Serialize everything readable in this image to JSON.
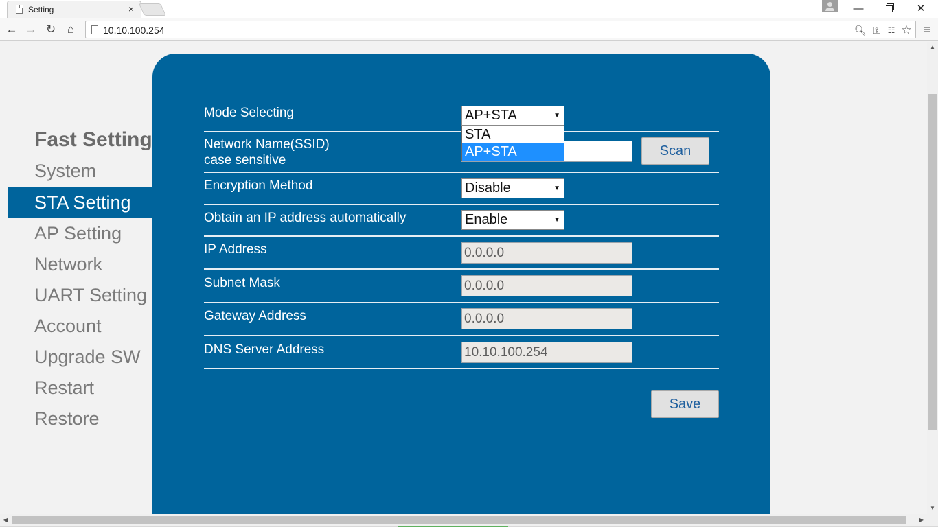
{
  "browser": {
    "tab_title": "Setting",
    "tab_close": "×",
    "url": "10.10.100.254",
    "win_min": "—",
    "win_close": "✕",
    "icons": [
      "back-icon",
      "forward-icon",
      "reload-icon",
      "home-icon",
      "zoom-icon",
      "key-icon",
      "translate-icon",
      "star-icon",
      "menu-icon"
    ]
  },
  "sidebar": {
    "title": "Fast Setting",
    "items": [
      {
        "label": "System"
      },
      {
        "label": "STA Setting",
        "active": true
      },
      {
        "label": "AP Setting"
      },
      {
        "label": "Network"
      },
      {
        "label": "UART Setting"
      },
      {
        "label": "Account"
      },
      {
        "label": "Upgrade SW"
      },
      {
        "label": "Restart"
      },
      {
        "label": "Restore"
      }
    ]
  },
  "form": {
    "mode": {
      "label": "Mode Selecting",
      "value": "AP+STA",
      "options": [
        "STA",
        "AP+STA"
      ],
      "highlighted_option": "AP+STA"
    },
    "ssid": {
      "label_line1": "Network Name(SSID)",
      "label_line2": "case sensitive",
      "value": "",
      "scan_label": "Scan"
    },
    "encryption": {
      "label": "Encryption Method",
      "value": "Disable"
    },
    "dhcp": {
      "label": "Obtain an IP address automatically",
      "value": "Enable"
    },
    "ip": {
      "label": "IP Address",
      "value": "0.0.0.0"
    },
    "mask": {
      "label": "Subnet Mask",
      "value": "0.0.0.0"
    },
    "gateway": {
      "label": "Gateway Address",
      "value": "0.0.0.0"
    },
    "dns": {
      "label": "DNS Server Address",
      "value": "10.10.100.254"
    },
    "save_label": "Save"
  },
  "colors": {
    "panel": "#00649c",
    "active_nav": "#00649c",
    "dropdown_highlight": "#1e90ff"
  }
}
